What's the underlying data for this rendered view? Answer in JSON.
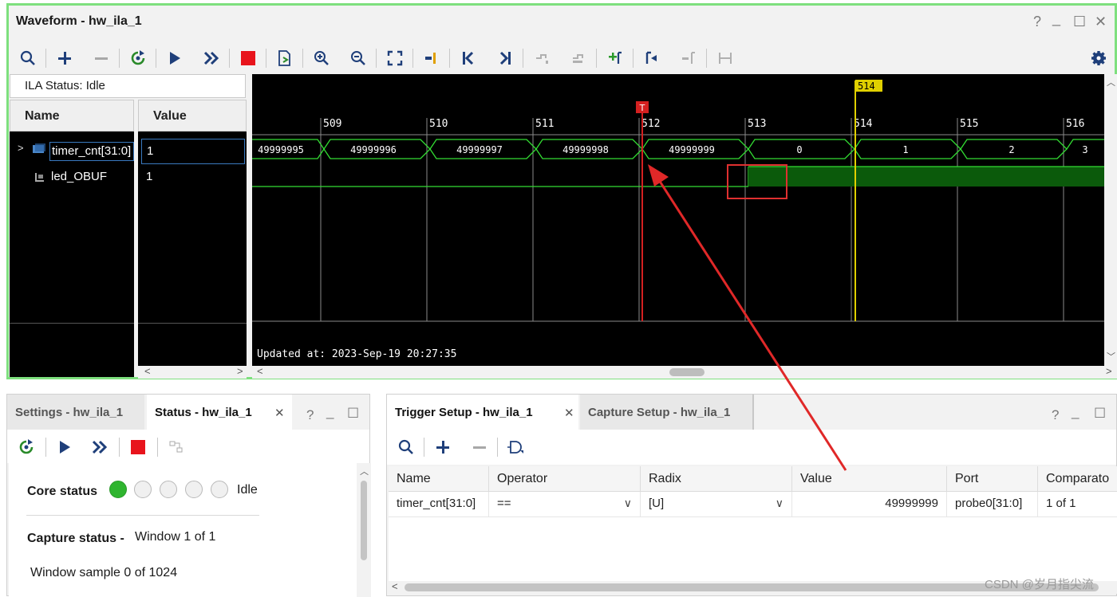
{
  "waveform": {
    "title": "Waveform - hw_ila_1",
    "window_controls": {
      "help": "?",
      "minimize": "_",
      "maximize": "☐",
      "close": "✕"
    },
    "ila_status": "ILA Status: Idle",
    "columns": {
      "name": "Name",
      "value": "Value"
    },
    "signals": [
      {
        "name": "timer_cnt[31:0]",
        "value": "1"
      },
      {
        "name": "led_OBUF",
        "value": "1"
      }
    ],
    "time_markers": [
      "509",
      "510",
      "511",
      "512",
      "513",
      "514",
      "515",
      "516"
    ],
    "cursor_label": "514",
    "trigger_label": "T",
    "bus_values": [
      "49999995",
      "49999996",
      "49999997",
      "49999998",
      "49999999",
      "0",
      "1",
      "2",
      "3"
    ],
    "updated_at": "Updated at: 2023-Sep-19 20:27:35",
    "colors": {
      "background": "#000000",
      "trace": "#33dd33",
      "cursor": "#e0d000",
      "trigger": "#d42020",
      "highlight": "#e03030"
    }
  },
  "status_panel": {
    "tabs": [
      {
        "label": "Settings - hw_ila_1",
        "active": false
      },
      {
        "label": "Status - hw_ila_1",
        "active": true
      }
    ],
    "close": "✕",
    "controls": {
      "help": "?",
      "minimize": "_",
      "maximize": "☐"
    },
    "core_status_label": "Core status",
    "core_status_value": "Idle",
    "capture_status_label": "Capture status -",
    "capture_status_value": "Window 1 of 1",
    "window_sample": "Window sample 0 of 1024"
  },
  "trigger_panel": {
    "tabs": [
      {
        "label": "Trigger Setup - hw_ila_1",
        "active": true
      },
      {
        "label": "Capture Setup - hw_ila_1",
        "active": false
      }
    ],
    "close": "✕",
    "controls": {
      "help": "?",
      "minimize": "_",
      "maximize": "☐"
    },
    "headers": [
      "Name",
      "Operator",
      "Radix",
      "Value",
      "Port",
      "Comparato"
    ],
    "row": {
      "name": "timer_cnt[31:0]",
      "operator": "==",
      "radix": "[U]",
      "value": "49999999",
      "port": "probe0[31:0]",
      "comparator": "1 of 1"
    }
  },
  "watermark": "CSDN @岁月指尖流"
}
